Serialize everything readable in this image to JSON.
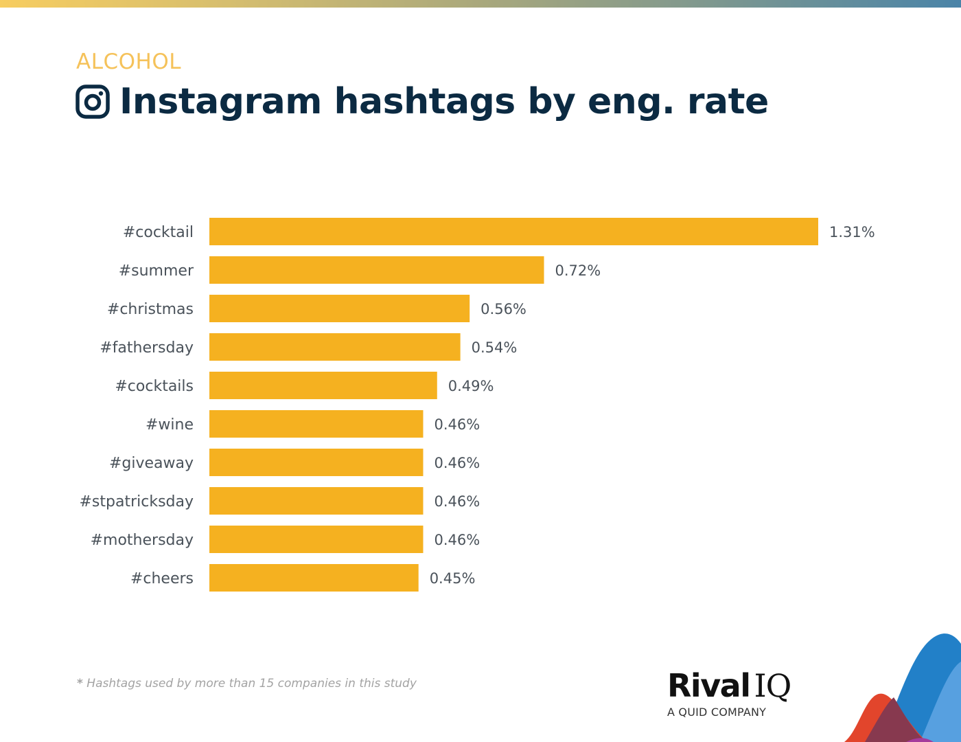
{
  "header": {
    "category": "ALCOHOL",
    "title": "Instagram hashtags by eng. rate",
    "icon": "instagram-icon"
  },
  "colors": {
    "bar": "#f5b120",
    "title": "#0b2a42",
    "category": "#f5c25a",
    "label": "#4a525a",
    "footnote": "#a3a3a3"
  },
  "chart_data": {
    "type": "bar",
    "orientation": "horizontal",
    "title": "Instagram hashtags by eng. rate",
    "subtitle": "ALCOHOL",
    "xlabel": "",
    "ylabel": "",
    "unit": "%",
    "xlim": [
      0,
      1.31
    ],
    "grid": false,
    "legend": "none",
    "categories": [
      "#cocktail",
      "#summer",
      "#christmas",
      "#fathersday",
      "#cocktails",
      "#wine",
      "#giveaway",
      "#stpatricksday",
      "#mothersday",
      "#cheers"
    ],
    "values": [
      1.31,
      0.72,
      0.56,
      0.54,
      0.49,
      0.46,
      0.46,
      0.46,
      0.46,
      0.45
    ],
    "value_labels": [
      "1.31%",
      "0.72%",
      "0.56%",
      "0.54%",
      "0.49%",
      "0.46%",
      "0.46%",
      "0.46%",
      "0.46%",
      "0.45%"
    ]
  },
  "footnote": {
    "star": "*",
    "text": " Hashtags used by more than 15 companies in this study"
  },
  "logo": {
    "brand_bold": "Rival",
    "brand_light": "IQ",
    "tagline": "A QUID COMPANY"
  }
}
